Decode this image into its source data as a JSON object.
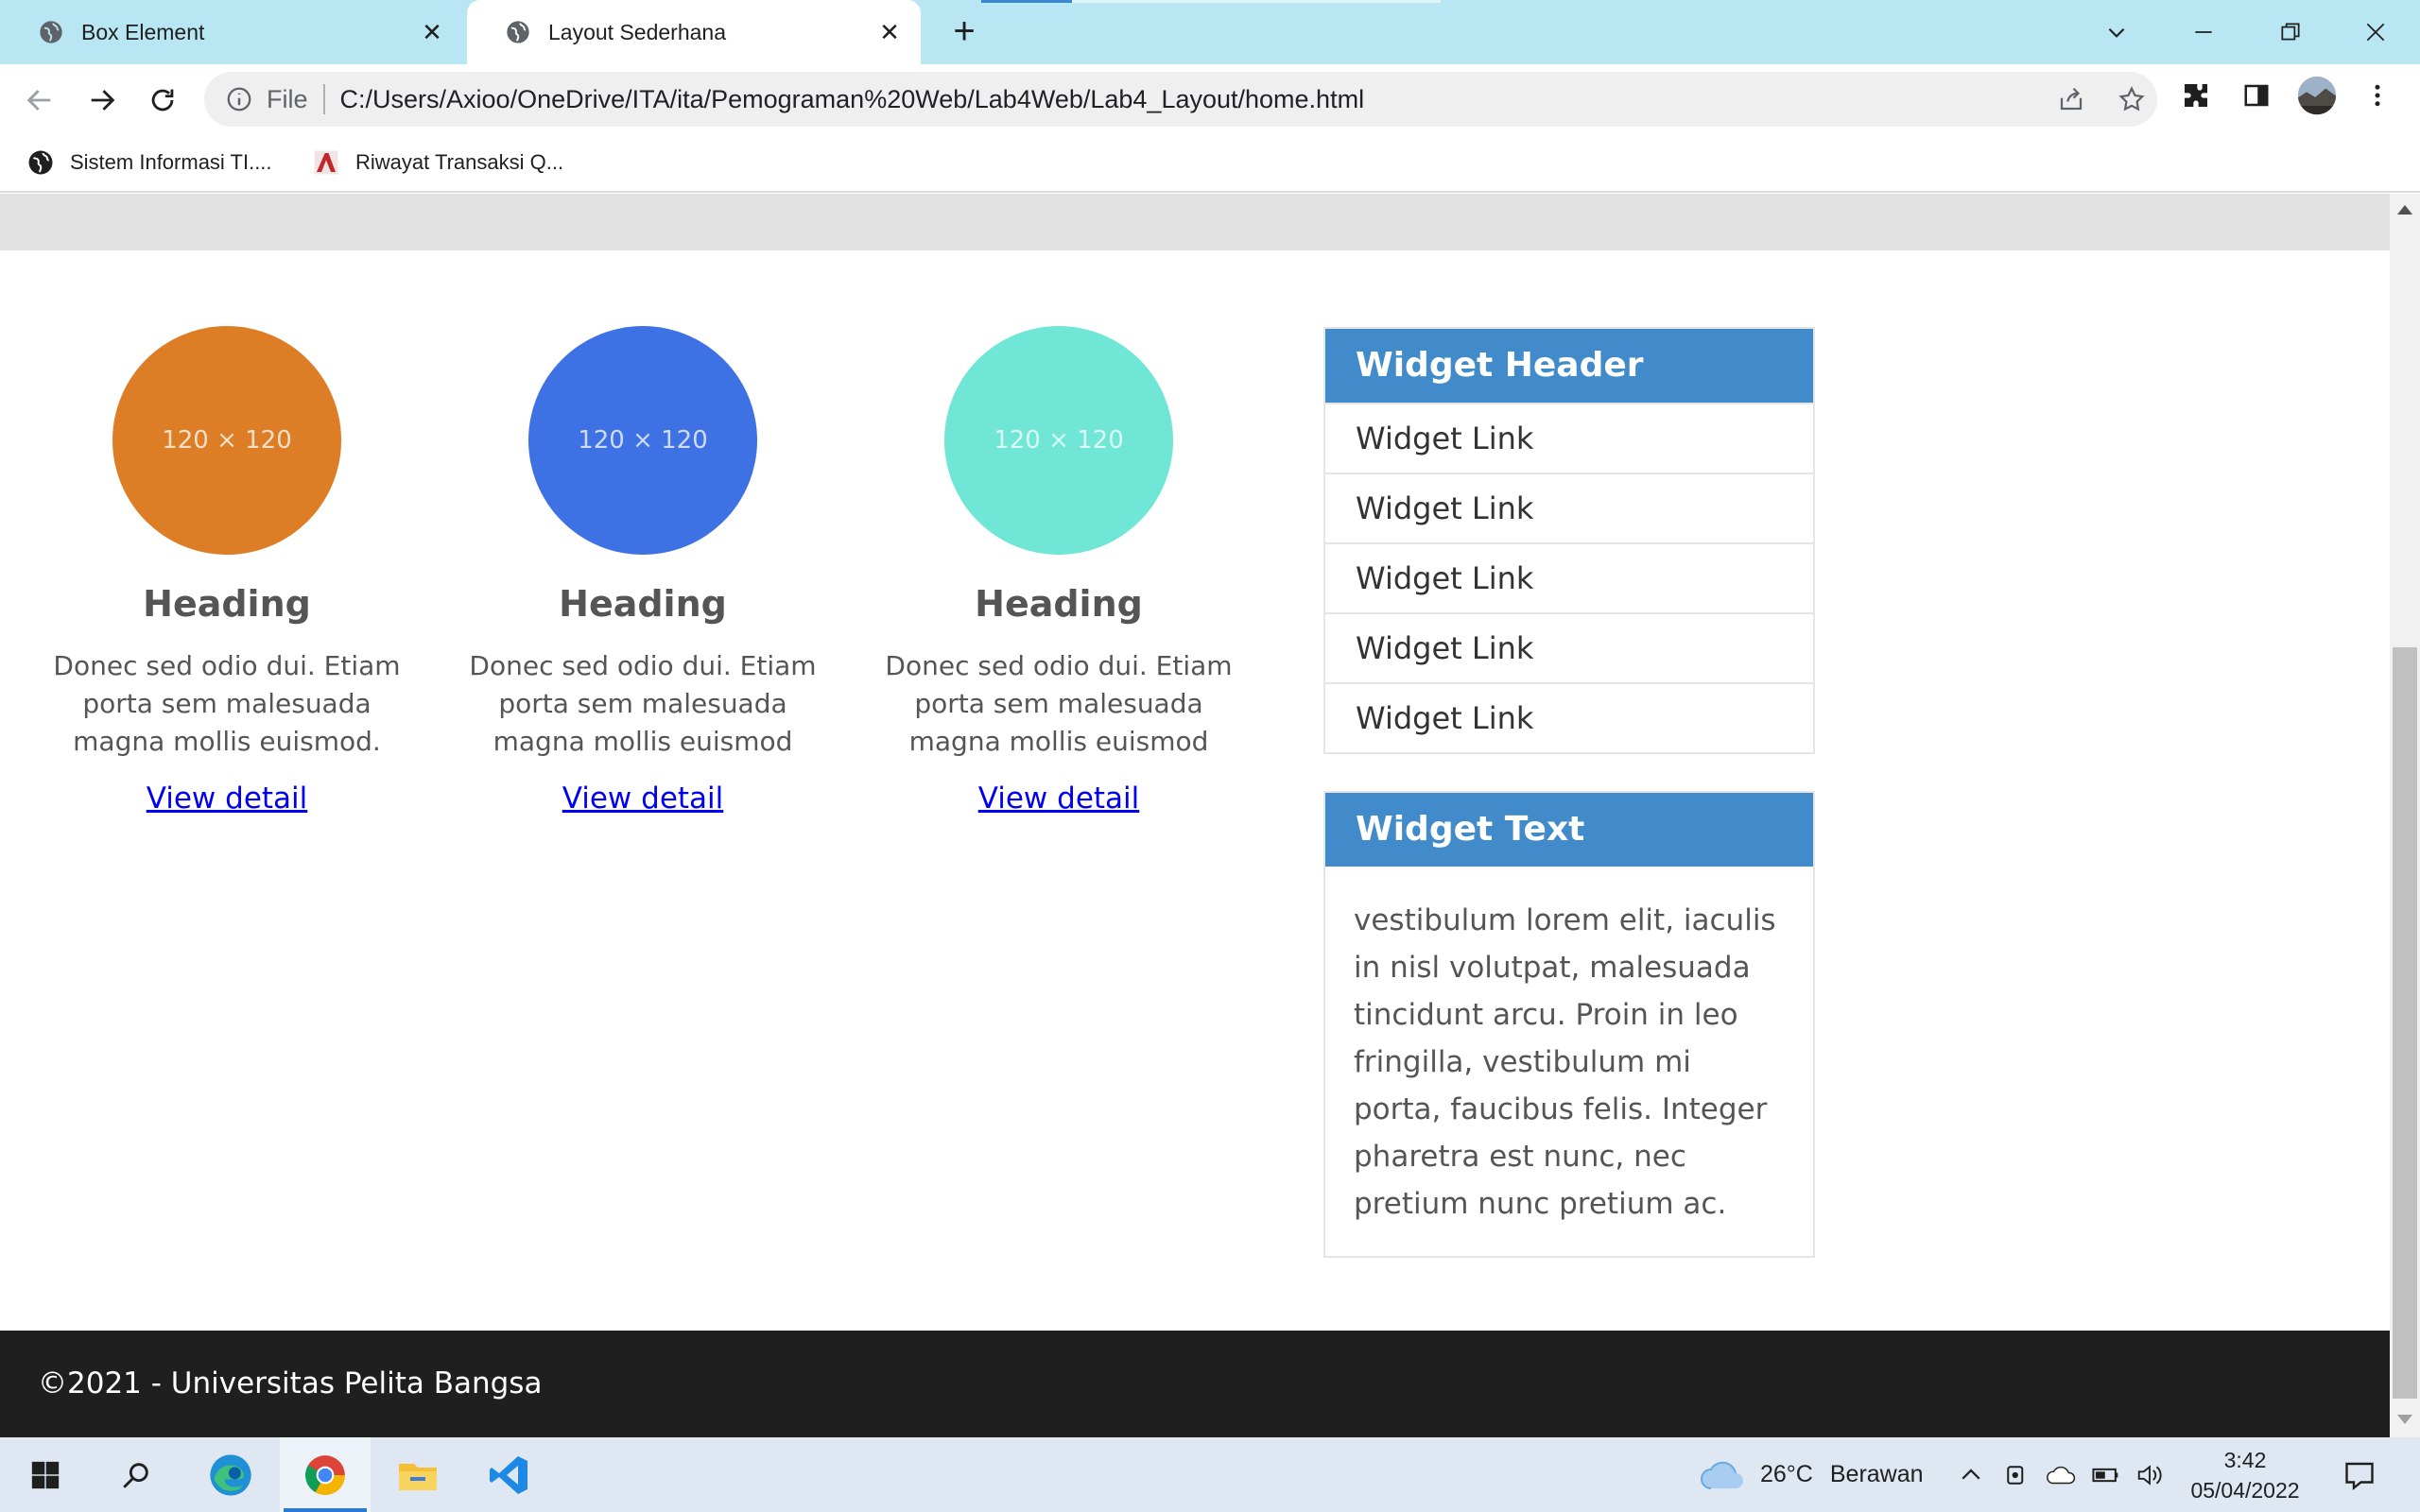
{
  "browser": {
    "tabs": [
      {
        "title": "Box Element",
        "active": false
      },
      {
        "title": "Layout Sederhana",
        "active": true
      }
    ],
    "address_bar": {
      "scheme_label": "File",
      "url": "C:/Users/Axioo/OneDrive/ITA/ita/Pemograman%20Web/Lab4Web/Lab4_Layout/home.html"
    },
    "bookmarks": [
      {
        "label": "Sistem Informasi TI...."
      },
      {
        "label": "Riwayat Transaksi Q..."
      }
    ]
  },
  "page": {
    "features": [
      {
        "placeholder": "120 × 120",
        "color": "#dd7e26",
        "heading": "Heading",
        "text": "Donec sed odio dui. Etiam porta sem malesuada magna mollis euismod.",
        "link": "View detail"
      },
      {
        "placeholder": "120 × 120",
        "color": "#3e71e3",
        "heading": "Heading",
        "text": "Donec sed odio dui. Etiam porta sem malesuada magna mollis euismod",
        "link": "View detail"
      },
      {
        "placeholder": "120 × 120",
        "color": "#70e6d6",
        "heading": "Heading",
        "text": "Donec sed odio dui. Etiam porta sem malesuada magna mollis euismod",
        "link": "View detail"
      }
    ],
    "widget_links": {
      "header": "Widget Header",
      "links": [
        "Widget Link",
        "Widget Link",
        "Widget Link",
        "Widget Link",
        "Widget Link"
      ]
    },
    "widget_text": {
      "header": "Widget Text",
      "body": "vestibulum lorem elit, iaculis in nisl volutpat, malesuada tincidunt arcu. Proin in leo fringilla, vestibulum mi porta, faucibus felis. Integer pharetra est nunc, nec pretium nunc pretium ac."
    },
    "footer": "©2021 - Universitas Pelita Bangsa",
    "accent_color": "#428bca"
  },
  "taskbar": {
    "weather_temp": "26°C",
    "weather_desc": "Berawan",
    "time": "3:42",
    "date": "05/04/2022"
  }
}
